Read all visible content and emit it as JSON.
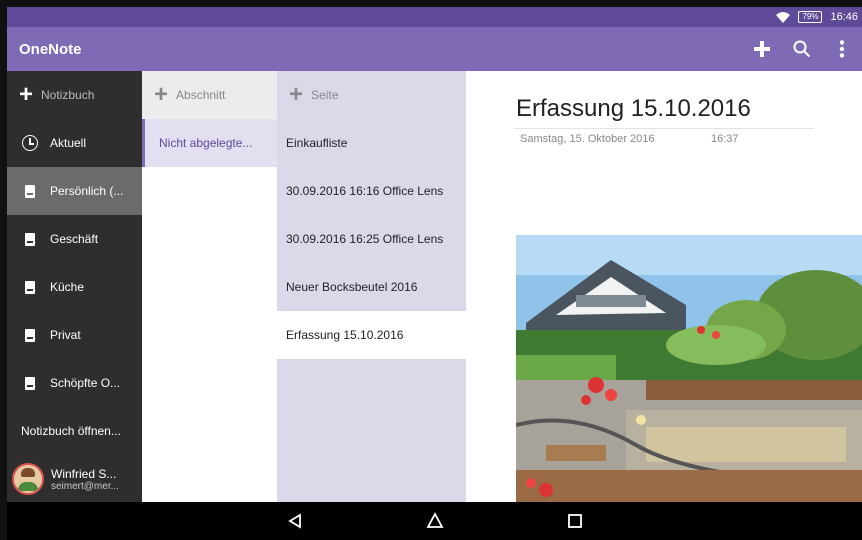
{
  "status": {
    "battery": "79%",
    "time": "16:46"
  },
  "app": {
    "title": "OneNote"
  },
  "notebooks": {
    "add_label": "Notizbuch",
    "items": [
      {
        "label": "Aktuell",
        "icon": "clock-icon"
      },
      {
        "label": "Persönlich (...",
        "icon": "notebook-icon",
        "selected": true
      },
      {
        "label": "Geschäft",
        "icon": "notebook-icon"
      },
      {
        "label": "Küche",
        "icon": "notebook-icon"
      },
      {
        "label": "Privat",
        "icon": "notebook-icon"
      },
      {
        "label": "Schöpfte O...",
        "icon": "notebook-icon"
      }
    ],
    "open_label": "Notizbuch öffnen...",
    "profile": {
      "name": "Winfried S...",
      "email": "seimert@mer..."
    }
  },
  "sections": {
    "add_label": "Abschnitt",
    "items": [
      {
        "label": "Nicht abgelegte...",
        "selected": true
      }
    ]
  },
  "pages": {
    "add_label": "Seite",
    "items": [
      {
        "label": "Einkaufliste"
      },
      {
        "label": "30.09.2016 16:16 Office Lens"
      },
      {
        "label": "30.09.2016 16:25 Office Lens"
      },
      {
        "label": "Neuer Bocksbeutel 2016"
      },
      {
        "label": "Erfassung 15.10.2016",
        "selected": true
      }
    ]
  },
  "note": {
    "title": "Erfassung 15.10.2016",
    "date": "Samstag, 15. Oktober 2016",
    "time": "16:37"
  },
  "colors": {
    "header": "#7f6ab5",
    "statusbar": "#5f4a99",
    "notebook_panel": "#2e2e2e",
    "pages_panel": "#dcd8ea"
  }
}
